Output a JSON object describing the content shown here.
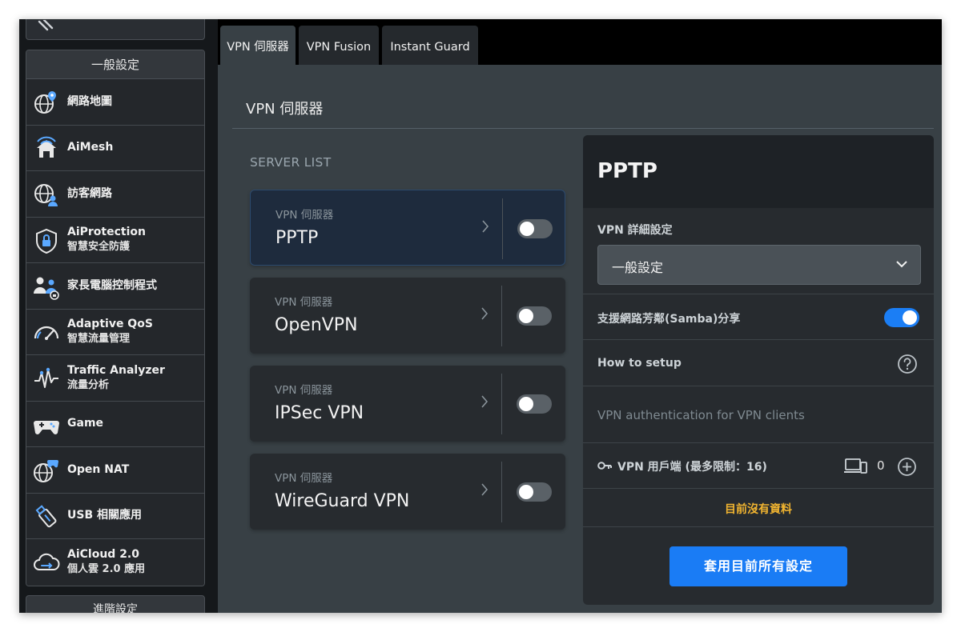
{
  "sidebar": {
    "group_general": "一般設定",
    "items": [
      {
        "title": "網路地圖",
        "sub": "",
        "icon": "network-map-icon"
      },
      {
        "title": "AiMesh",
        "sub": "",
        "icon": "aimesh-icon"
      },
      {
        "title": "訪客網路",
        "sub": "",
        "icon": "guest-network-icon"
      },
      {
        "title": "AiProtection",
        "sub": "智慧安全防護",
        "icon": "shield-lock-icon"
      },
      {
        "title": "家長電腦控制程式",
        "sub": "",
        "icon": "parental-control-icon"
      },
      {
        "title": "Adaptive QoS",
        "sub": "智慧流量管理",
        "icon": "gauge-icon"
      },
      {
        "title": "Traffic Analyzer",
        "sub": "流量分析",
        "icon": "traffic-analyzer-icon"
      },
      {
        "title": "Game",
        "sub": "",
        "icon": "gamepad-icon"
      },
      {
        "title": "Open NAT",
        "sub": "",
        "icon": "open-nat-icon"
      },
      {
        "title": "USB 相關應用",
        "sub": "",
        "icon": "usb-icon"
      },
      {
        "title": "AiCloud 2.0",
        "sub": "個人雲 2.0 應用",
        "icon": "cloud-icon"
      }
    ],
    "group_advanced": "進階設定"
  },
  "tabs": [
    {
      "label": "VPN 伺服器",
      "active": true
    },
    {
      "label": "VPN Fusion",
      "active": false
    },
    {
      "label": "Instant Guard",
      "active": false
    }
  ],
  "main": {
    "title": "VPN 伺服器",
    "server_list_label": "SERVER LIST",
    "servers": [
      {
        "sub": "VPN 伺服器",
        "name": "PPTP",
        "enabled": false,
        "selected": true
      },
      {
        "sub": "VPN 伺服器",
        "name": "OpenVPN",
        "enabled": false,
        "selected": false
      },
      {
        "sub": "VPN 伺服器",
        "name": "IPSec VPN",
        "enabled": false,
        "selected": false
      },
      {
        "sub": "VPN 伺服器",
        "name": "WireGuard VPN",
        "enabled": false,
        "selected": false
      }
    ]
  },
  "panel": {
    "title": "PPTP",
    "detail_label": "VPN 詳細設定",
    "detail_value": "一般設定",
    "samba_label": "支援網路芳鄰(Samba)分享",
    "samba_enabled": true,
    "how_to_setup": "How to setup",
    "auth_desc": "VPN authentication for VPN clients",
    "clients_label": "VPN 用戶端 (最多限制：16)",
    "client_count": "0",
    "no_data": "目前沒有資料",
    "apply_label": "套用目前所有設定"
  },
  "colors": {
    "accent": "#1a7cf5",
    "warning": "#f2b530",
    "panel_bg": "#272b2f",
    "main_bg": "#384045"
  }
}
